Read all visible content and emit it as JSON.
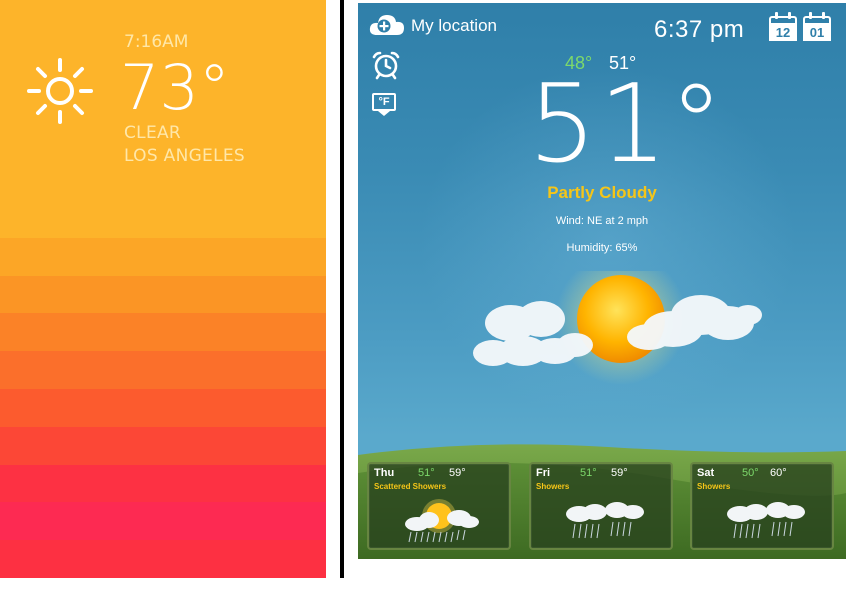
{
  "left": {
    "time": "7:16AM",
    "temperature": "73°",
    "condition": "CLEAR",
    "city": "LOS ANGELES",
    "icon": "sun-icon",
    "stripe_colors": [
      "#fdb42a",
      "#fdb42a",
      "#fca626",
      "#fb9525",
      "#fb8227",
      "#fb6f2b",
      "#fc5b2e",
      "#fc4736",
      "#fd3143",
      "#fd2a52",
      "#fd3042"
    ]
  },
  "right": {
    "location_label": "My location",
    "clock": "6:37 pm",
    "calendar_month": "12",
    "calendar_day": "01",
    "high": "48°",
    "low": "51°",
    "current_temp": "51°",
    "condition": "Partly Cloudy",
    "wind": "Wind: NE at 2 mph",
    "humidity": "Humidity: 65%",
    "unit": "°F",
    "icons": [
      "cloud-plus-icon",
      "alarm-clock-icon",
      "fahrenheit-unit-icon",
      "sun-cloud-icon"
    ],
    "colors": {
      "accent_yellow": "#f5c518",
      "high_green": "#7dd96b",
      "sky": "#3a8bb4"
    },
    "forecast": [
      {
        "day": "Thu",
        "high": "51°",
        "low": "59°",
        "condition": "Scattered Showers",
        "icon": "sun-rain-icon"
      },
      {
        "day": "Fri",
        "high": "51°",
        "low": "59°",
        "condition": "Showers",
        "icon": "rain-cloud-icon"
      },
      {
        "day": "Sat",
        "high": "50°",
        "low": "60°",
        "condition": "Showers",
        "icon": "rain-cloud-icon"
      }
    ]
  }
}
